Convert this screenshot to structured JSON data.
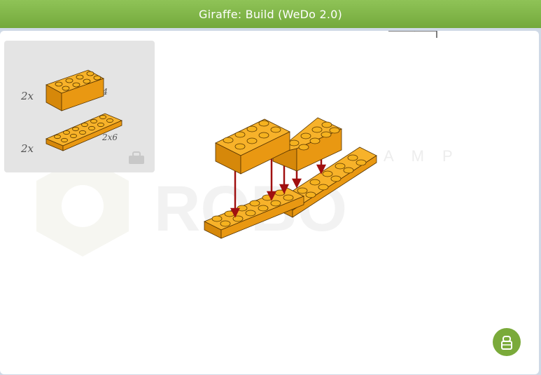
{
  "window": {
    "title": "Giraffe: Build (WeDo 2.0)"
  },
  "parts_list": [
    {
      "qty": "2x",
      "size": "2x4"
    },
    {
      "qty": "2x",
      "size": "2x6"
    }
  ],
  "watermark": {
    "word": "ROBO",
    "top": "A M P"
  },
  "colors": {
    "brick": "#f0a010",
    "header": "#7cb342",
    "arrow": "#a01010",
    "fab": "#7aaa3a"
  },
  "icons": {
    "parts_toggle": "bag-icon",
    "fab": "bag-icon"
  }
}
